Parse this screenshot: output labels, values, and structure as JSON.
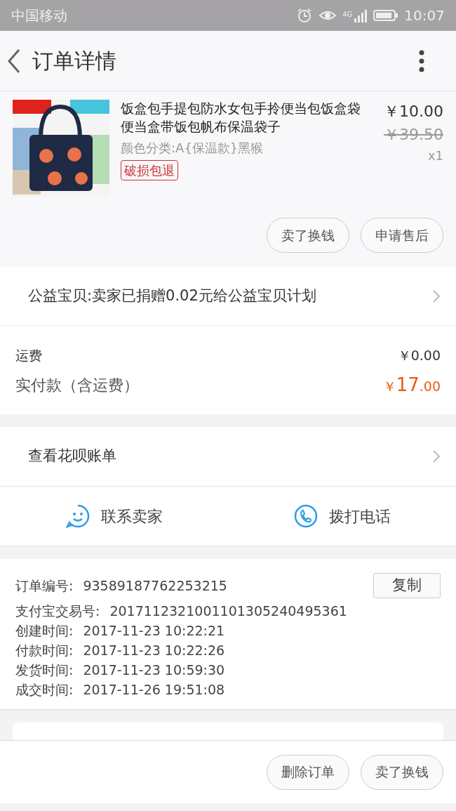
{
  "status_bar": {
    "carrier": "中国移动",
    "network": "4G",
    "time": "10:07"
  },
  "header": {
    "title": "订单详情"
  },
  "product": {
    "title": "饭盒包手提包防水女包手拎便当包饭盒袋便当盒带饭包帆布保温袋子",
    "variant": "颜色分类:A{保温款}黑猴",
    "tag": "破损包退",
    "price": "￥10.00",
    "original_price": "￥39.50",
    "quantity": "x1",
    "buttons": [
      "卖了换钱",
      "申请售后"
    ]
  },
  "charity": {
    "text": "公益宝贝:卖家已捐赠0.02元给公益宝贝计划"
  },
  "fees": {
    "shipping_label": "运费",
    "shipping_value": "￥0.00",
    "total_label": "实付款（含运费）",
    "total_currency": "￥",
    "total_integer": "17",
    "total_decimal": ".00"
  },
  "huabei": {
    "text": "查看花呗账单"
  },
  "contact": [
    {
      "kind": "chat",
      "label": "联系卖家"
    },
    {
      "kind": "phone",
      "label": "拨打电话"
    }
  ],
  "order_info": {
    "copy_button": "复制",
    "rows": [
      {
        "label": "订单编号:",
        "value": "93589187762253215"
      },
      {
        "label": "支付宝交易号:",
        "value": "2017112321001101305240495361"
      },
      {
        "label": "创建时间:",
        "value": "2017-11-23 10:22:21"
      },
      {
        "label": "付款时间:",
        "value": "2017-11-23 10:22:26"
      },
      {
        "label": "发货时间:",
        "value": "2017-11-23 10:59:30"
      },
      {
        "label": "成交时间:",
        "value": "2017-11-26 19:51:08"
      }
    ]
  },
  "bottom_bar": {
    "buttons": [
      "删除订单",
      "卖了换钱"
    ]
  }
}
